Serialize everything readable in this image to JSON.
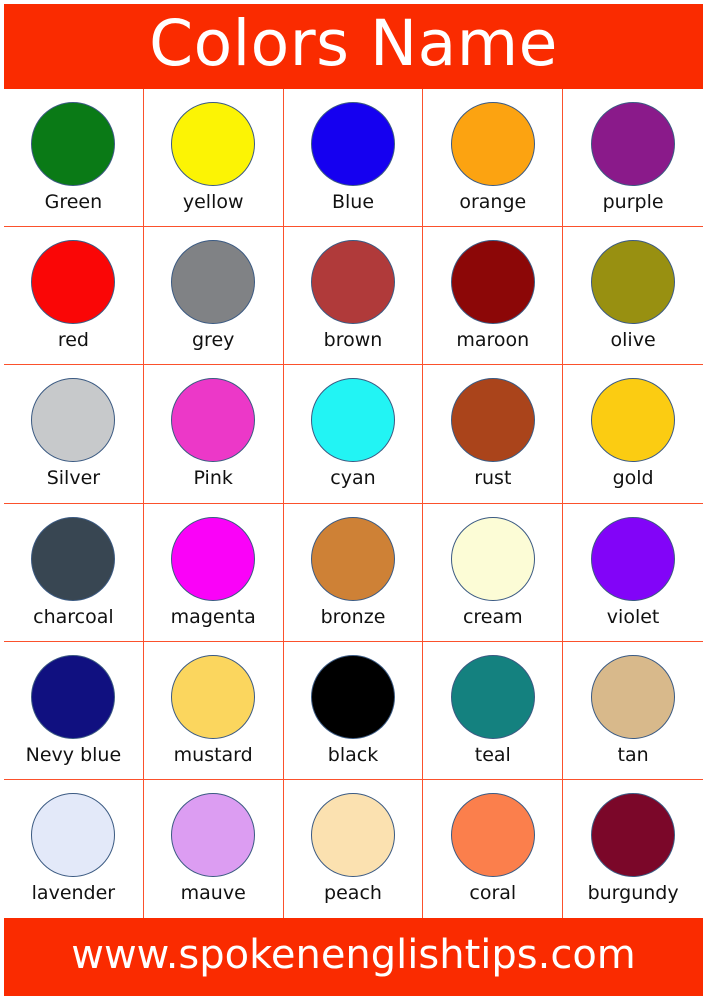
{
  "header": {
    "title": "Colors Name",
    "background_color": "#fa2b00",
    "text_color": "#ffffff"
  },
  "footer": {
    "website": "www.spokenenglishtips.com",
    "background_color": "#fa2b00",
    "text_color": "#ffffff"
  },
  "grid": {
    "columns": 5,
    "rows": 6,
    "line_color": "#fb512c",
    "swatch_border_color": "#3b5a82"
  },
  "swatches": [
    {
      "label": "Green",
      "color": "#0a7a16"
    },
    {
      "label": "yellow",
      "color": "#fcf404"
    },
    {
      "label": "Blue",
      "color": "#1500f0"
    },
    {
      "label": "orange",
      "color": "#fca311"
    },
    {
      "label": "purple",
      "color": "#8a1a8a"
    },
    {
      "label": "red",
      "color": "#fa0606"
    },
    {
      "label": "grey",
      "color": "#808285"
    },
    {
      "label": "brown",
      "color": "#b03a3a"
    },
    {
      "label": "maroon",
      "color": "#8c0707"
    },
    {
      "label": "olive",
      "color": "#989011"
    },
    {
      "label": "Silver",
      "color": "#c7c9cb"
    },
    {
      "label": "Pink",
      "color": "#ec38c8"
    },
    {
      "label": "cyan",
      "color": "#22f4f4"
    },
    {
      "label": "rust",
      "color": "#aa441b"
    },
    {
      "label": "gold",
      "color": "#fbcc12"
    },
    {
      "label": "charcoal",
      "color": "#384652"
    },
    {
      "label": "magenta",
      "color": "#fa02f8"
    },
    {
      "label": "bronze",
      "color": "#ce8136"
    },
    {
      "label": "cream",
      "color": "#fcfcd6"
    },
    {
      "label": "violet",
      "color": "#8204f8"
    },
    {
      "label": "Nevy blue",
      "color": "#101080"
    },
    {
      "label": "mustard",
      "color": "#fbd65e"
    },
    {
      "label": "black",
      "color": "#000000"
    },
    {
      "label": "teal",
      "color": "#14817f"
    },
    {
      "label": "tan",
      "color": "#d8b98b"
    },
    {
      "label": "lavender",
      "color": "#e3e9f9"
    },
    {
      "label": "mauve",
      "color": "#dc9df2"
    },
    {
      "label": "peach",
      "color": "#fbe1b0"
    },
    {
      "label": "coral",
      "color": "#fb7f4c"
    },
    {
      "label": "burgundy",
      "color": "#7b0729"
    }
  ]
}
